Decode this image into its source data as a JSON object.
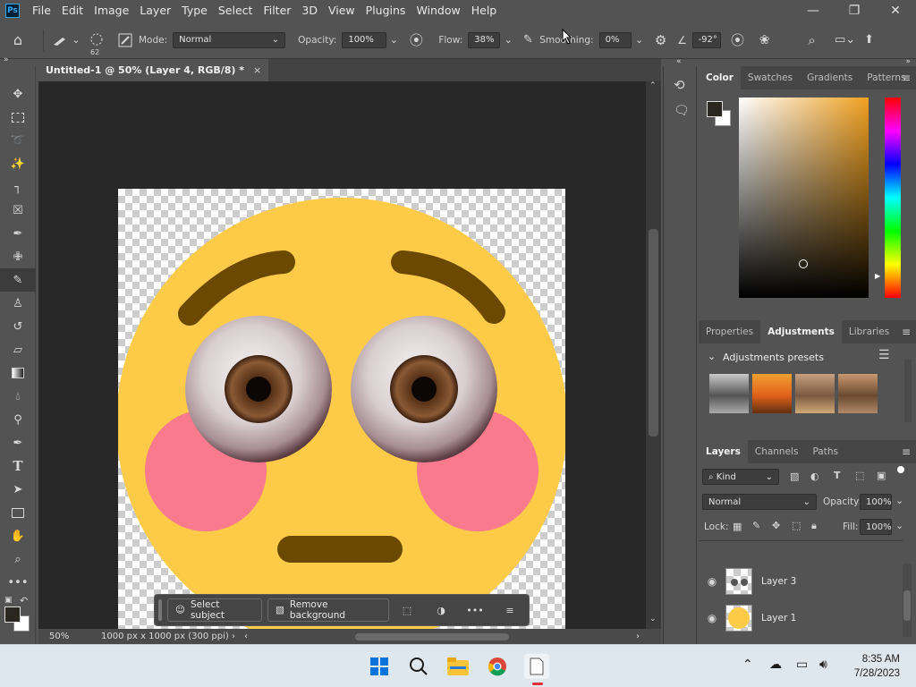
{
  "menubar": {
    "logo": "Ps",
    "items": [
      "File",
      "Edit",
      "Image",
      "Layer",
      "Type",
      "Select",
      "Filter",
      "3D",
      "View",
      "Plugins",
      "Window",
      "Help"
    ],
    "window_controls": [
      "minimize-icon",
      "restore-icon",
      "close-icon"
    ]
  },
  "options": {
    "brush_size": "62",
    "mode_label": "Mode:",
    "mode_value": "Normal",
    "opacity_label": "Opacity:",
    "opacity_value": "100%",
    "flow_label": "Flow:",
    "flow_value": "38%",
    "smoothing_label": "Smoothing:",
    "smoothing_value": "0%",
    "angle_value": "-92°"
  },
  "document": {
    "tab_title": "Untitled-1 @ 50% (Layer 4, RGB/8) *",
    "zoom": "50%",
    "doc_info": "1000 px x 1000 px (300 ppi)"
  },
  "contextual_taskbar": {
    "select_subject": "Select subject",
    "remove_background": "Remove background"
  },
  "color_panel": {
    "tabs": [
      "Color",
      "Swatches",
      "Gradients",
      "Patterns"
    ],
    "active_tab": "Color",
    "foreground": "#2a2620",
    "background": "#ffffff",
    "hue_color": "#f0a020"
  },
  "adjustments_panel": {
    "tabs": [
      "Properties",
      "Adjustments",
      "Libraries"
    ],
    "active_tab": "Adjustments",
    "section_title": "Adjustments presets"
  },
  "layers_panel": {
    "tabs": [
      "Layers",
      "Channels",
      "Paths"
    ],
    "active_tab": "Layers",
    "filter_label": "Kind",
    "blend_mode": "Normal",
    "opacity_label": "Opacity:",
    "opacity_value": "100%",
    "lock_label": "Lock:",
    "fill_label": "Fill:",
    "fill_value": "100%",
    "layers": [
      {
        "name": "Layer 3"
      },
      {
        "name": "Layer 1"
      }
    ]
  },
  "taskbar": {
    "time": "8:35 AM",
    "date": "7/28/2023"
  },
  "colors": {
    "emoji_yellow": "#fecb48",
    "brow": "#6b4a00",
    "blush": "#f97a8c",
    "iris": "#6b4025"
  }
}
